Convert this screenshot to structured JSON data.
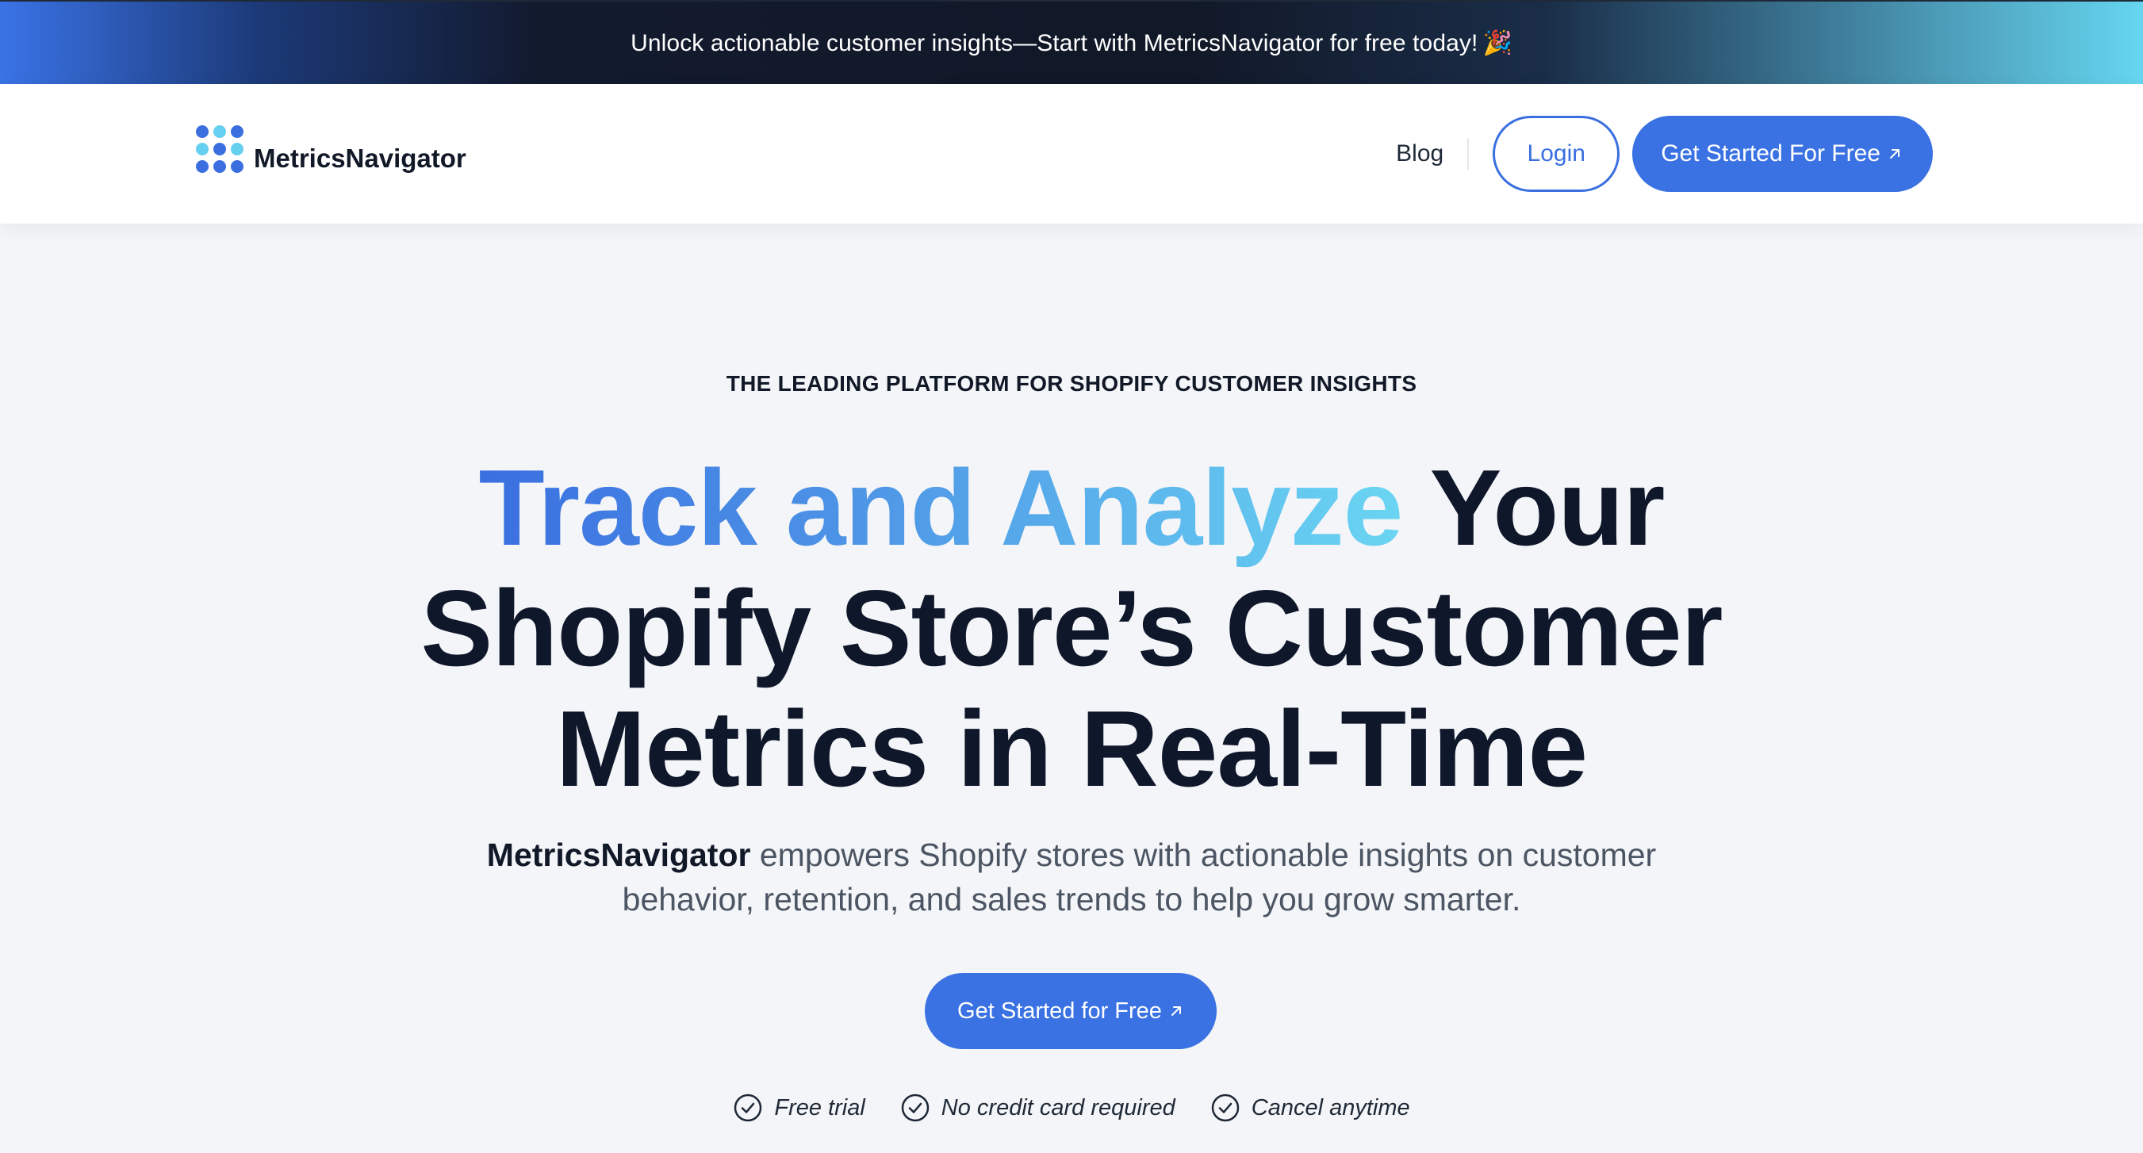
{
  "announcement": {
    "text": "Unlock actionable customer insights—Start with MetricsNavigator for free today!",
    "emoji": "🎉"
  },
  "nav": {
    "brand": "MetricsNavigator",
    "blog_label": "Blog",
    "login_label": "Login",
    "cta_label": "Get Started For Free"
  },
  "hero": {
    "eyebrow": "THE LEADING PLATFORM FOR SHOPIFY CUSTOMER INSIGHTS",
    "headline_highlight": "Track and Analyze",
    "headline_rest_line1": " Your",
    "headline_line2": "Shopify Store’s Customer",
    "headline_line3": "Metrics in Real-Time",
    "subhead_brand": "MetricsNavigator",
    "subhead_text": " empowers Shopify stores with actionable insights on customer behavior, retention, and sales trends to help you grow smarter.",
    "cta_label": "Get Started for Free",
    "perks": [
      "Free trial",
      "No credit card required",
      "Cancel anytime"
    ]
  },
  "colors": {
    "primary": "#3a72e3",
    "accent_light": "#66d0f0",
    "text_dark": "#0f172a",
    "background": "#f4f5f8"
  },
  "icons": {
    "logo": "dot-grid-logo",
    "cta_arrow": "arrow-up-right-icon",
    "perk_check": "check-circle-icon"
  }
}
